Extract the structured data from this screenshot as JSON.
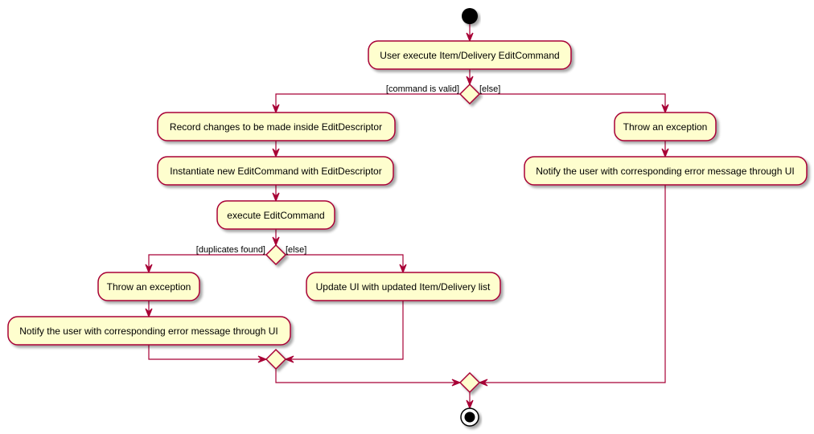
{
  "diagram": {
    "type": "activity",
    "colors": {
      "border": "#A80036",
      "fill": "#FEFECE",
      "shadow": "#cfcfcf",
      "node": "#000000"
    },
    "activities": {
      "user_execute": "User execute Item/Delivery EditCommand",
      "record_changes": "Record changes to be made inside EditDescriptor",
      "instantiate": "Instantiate new EditCommand with EditDescriptor",
      "execute": "execute EditCommand",
      "throw_left": "Throw an exception",
      "notify_left": "Notify the user with corresponding error message through UI",
      "update_ui": "Update UI with updated Item/Delivery list",
      "throw_right": "Throw an exception",
      "notify_right": "Notify the user with corresponding error message through UI"
    },
    "guards": {
      "valid": "[command is valid]",
      "else1": "[else]",
      "duplicates": "[duplicates found]",
      "else2": "[else]"
    }
  }
}
